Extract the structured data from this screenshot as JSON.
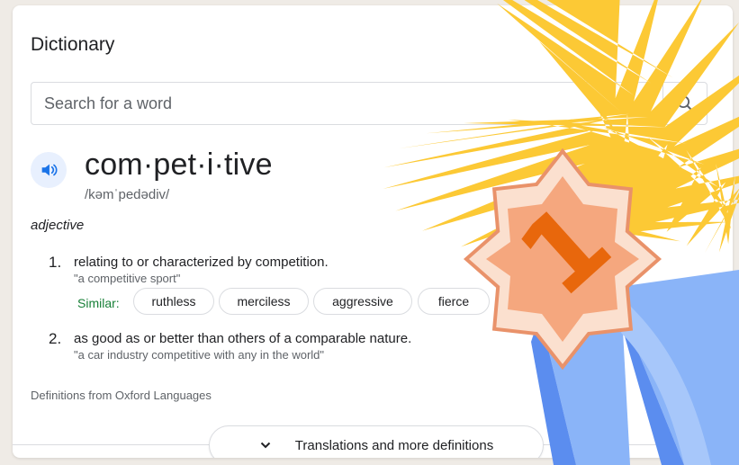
{
  "dictionary": {
    "title": "Dictionary",
    "search": {
      "placeholder": "Search for a word",
      "value": ""
    },
    "entry": {
      "word": "com·pet·i·tive",
      "phonetic": "/kəmˈpedədiv/",
      "part_of_speech": "adjective",
      "definitions": [
        {
          "number": "1.",
          "text": "relating to or characterized by competition.",
          "example": "\"a competitive sport\"",
          "similar_label": "Similar:",
          "similar": [
            "ruthless",
            "merciless",
            "aggressive",
            "fierce"
          ]
        },
        {
          "number": "2.",
          "text": "as good as or better than others of a comparable nature.",
          "example": "\"a car industry competitive with any in the world\""
        }
      ]
    },
    "source": "Definitions from Oxford Languages",
    "more_button": "Translations and more definitions"
  },
  "badge": {
    "number": "1",
    "icon": "first-place-award-ribbon-icon"
  },
  "colors": {
    "background": "#efebe6",
    "link_blue": "#1a73e8",
    "similar_green": "#188038",
    "burst_yellow": "#fcc935",
    "star_peach": "#f5a77e",
    "ribbon_blue": "#8ab4f8",
    "number_orange": "#e8670c"
  }
}
